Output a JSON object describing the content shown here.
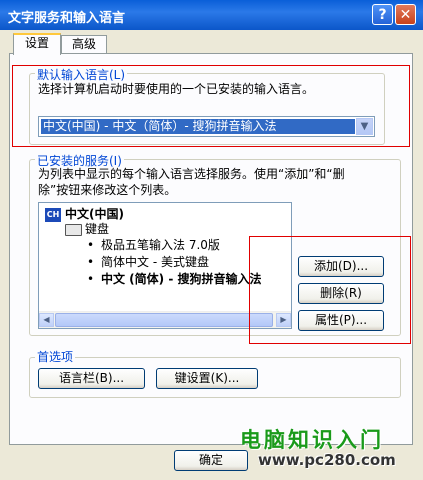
{
  "window": {
    "title": "文字服务和输入语言"
  },
  "tabs": [
    {
      "label": "设置",
      "selected": true
    },
    {
      "label": "高级",
      "selected": false
    }
  ],
  "default_lang": {
    "group_label": "默认输入语言(L)",
    "description": "选择计算机启动时要使用的一个已安装的输入语言。",
    "selected_value": "中文(中国) - 中文（简体）- 搜狗拼音输入法"
  },
  "installed": {
    "group_label": "已安装的服务(I)",
    "description_line1": "为列表中显示的每个输入语言选择服务。使用“添加”和“删",
    "description_line2": "除”按钮来修改这个列表。",
    "language": "中文(中国)",
    "language_badge": "CH",
    "category": "键盘",
    "services": [
      "极品五笔输入法 7.0版",
      "简体中文 - 美式键盘",
      "中文 (简体) - 搜狗拼音输入法"
    ],
    "add_button": "添加(D)...",
    "remove_button": "删除(R)",
    "properties_button": "属性(P)..."
  },
  "preferences": {
    "group_label": "首选项",
    "langbar_button": "语言栏(B)...",
    "keysettings_button": "键设置(K)..."
  },
  "footer": {
    "ok_button": "确定"
  },
  "watermark": {
    "line1": "电脑知识入门",
    "line2": "www.pc280.com"
  },
  "colors": {
    "accent": "#316ac5",
    "annotation_red": "#e00000",
    "group_label": "#0046d5"
  }
}
